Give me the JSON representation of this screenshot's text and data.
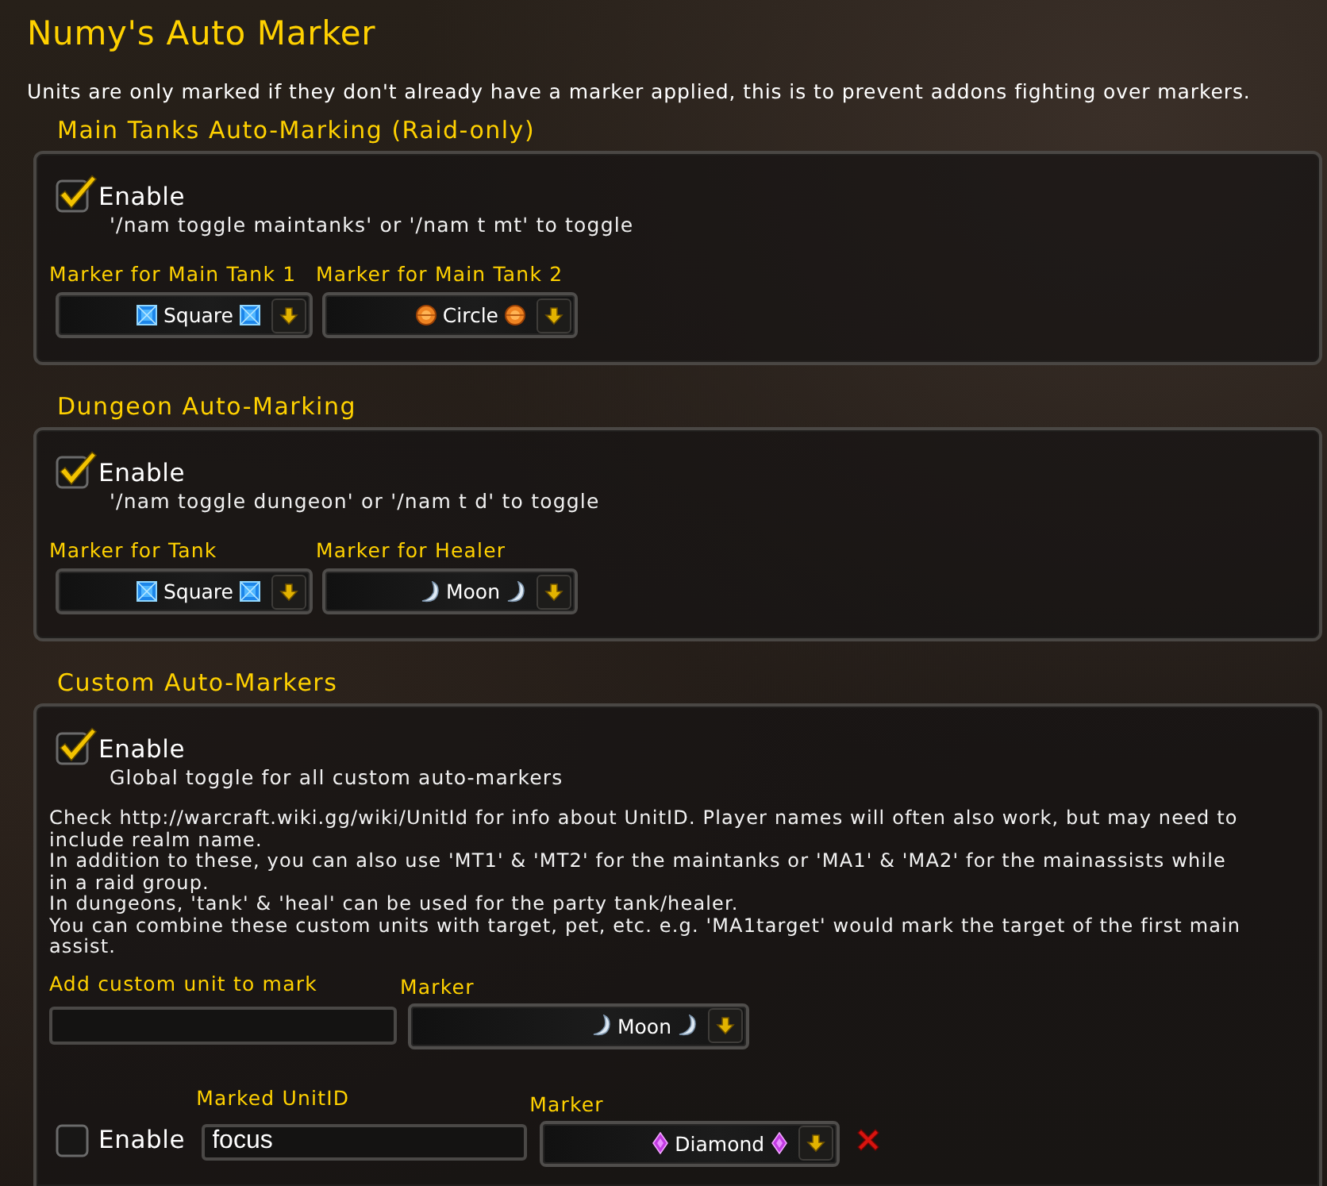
{
  "window": {
    "title": "Numy's Auto Marker"
  },
  "description": "Units are only marked if they don't already have a marker applied, this is to prevent addons fighting over markers.",
  "sections": [
    {
      "title": "Main Tanks Auto-Marking (Raid-only)",
      "enable": {
        "label": "Enable",
        "checked": true,
        "hint": "'/nam toggle maintanks' or '/nam t mt' to toggle"
      },
      "dropdowns": [
        {
          "label": "Marker for Main Tank 1",
          "value": "Square",
          "kind": "square"
        },
        {
          "label": "Marker for Main Tank 2",
          "value": "Circle",
          "kind": "circle"
        }
      ]
    },
    {
      "title": "Dungeon Auto-Marking",
      "enable": {
        "label": "Enable",
        "checked": true,
        "hint": "'/nam toggle dungeon' or '/nam t d' to toggle"
      },
      "dropdowns": [
        {
          "label": "Marker for Tank",
          "value": "Square",
          "kind": "square"
        },
        {
          "label": "Marker for Healer",
          "value": "Moon",
          "kind": "moon"
        }
      ]
    },
    {
      "title": "Custom Auto-Markers",
      "enable": {
        "label": "Enable",
        "checked": true,
        "hint": "Global toggle for all custom auto-markers"
      },
      "help": [
        "Check http://warcraft.wiki.gg/wiki/UnitId for info about UnitID. Player names will often also work, but may need to include realm name.",
        "In addition to these, you can also use 'MT1' & 'MT2' for the maintanks or 'MA1' & 'MA2' for the mainassists while in a raid group.",
        "In dungeons, 'tank' & 'heal' can be used for the party tank/healer.",
        "You can combine these custom units with target, pet, etc. e.g. 'MA1target' would mark the target of the first main assist."
      ],
      "add_unit": {
        "label": "Add custom unit to mark",
        "marker": {
          "label": "Marker",
          "value": "Moon",
          "kind": "moon"
        }
      },
      "units": [
        {
          "enable_label": "Enable",
          "checked": false,
          "field_label": "Marked UnitID",
          "value": "focus",
          "marker": {
            "label": "Marker",
            "value": "Diamond",
            "kind": "diamond"
          }
        }
      ]
    }
  ]
}
